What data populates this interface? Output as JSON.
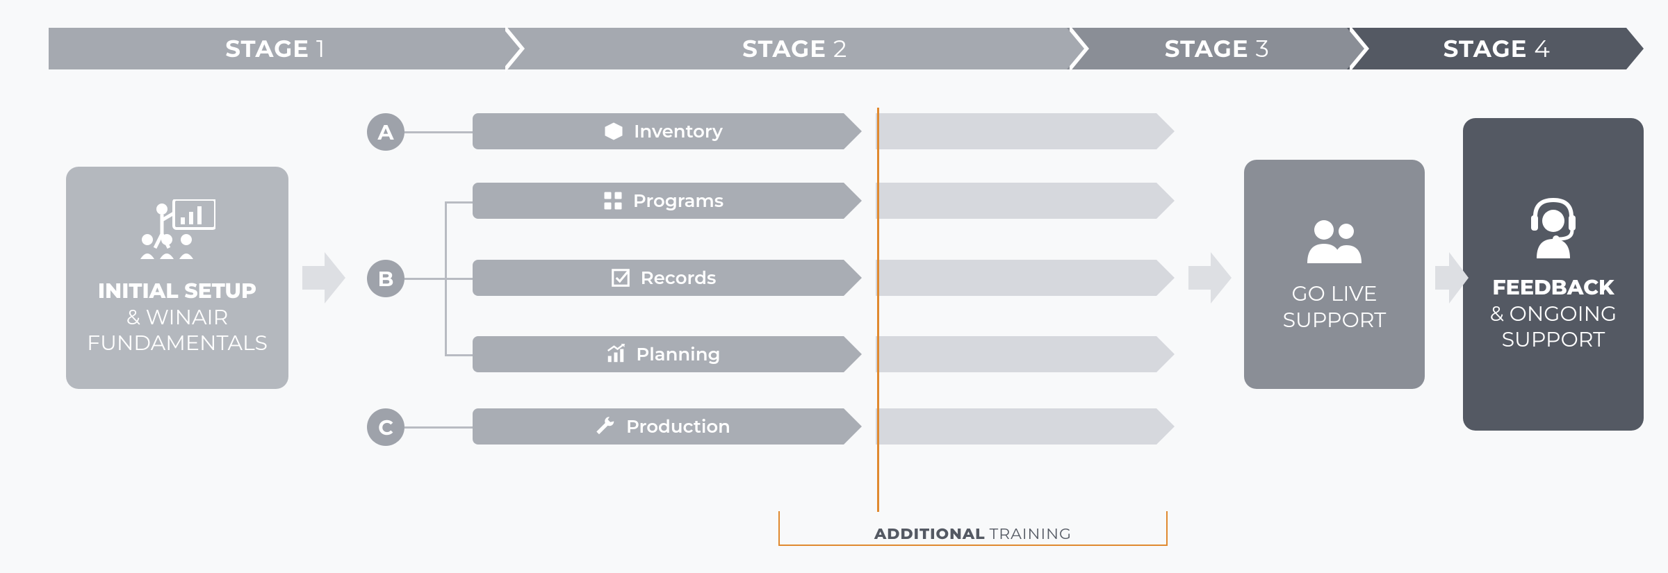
{
  "stages": {
    "s1": {
      "strong": "STAGE",
      "num": "1"
    },
    "s2": {
      "strong": "STAGE",
      "num": "2"
    },
    "s3": {
      "strong": "STAGE",
      "num": "3"
    },
    "s4": {
      "strong": "STAGE",
      "num": "4"
    }
  },
  "stage1": {
    "line1_strong": "INITIAL SETUP",
    "line2": "& WINAIR",
    "line3": "FUNDAMENTALS"
  },
  "stage3": {
    "line1": "GO LIVE",
    "line2": "SUPPORT"
  },
  "stage4": {
    "line1_strong": "FEEDBACK",
    "line2": "& ONGOING",
    "line3": "SUPPORT"
  },
  "letters": {
    "a": "A",
    "b": "B",
    "c": "C"
  },
  "modules": {
    "inventory": "Inventory",
    "programs": "Programs",
    "records": "Records",
    "planning": "Planning",
    "production": "Production"
  },
  "additional": {
    "strong": "ADDITIONAL",
    "rest": "TRAINING"
  },
  "colors": {
    "light_gray": "#a5a9b0",
    "mid_gray": "#8a8e96",
    "dark_gray": "#545963",
    "orange": "#e0892f"
  }
}
